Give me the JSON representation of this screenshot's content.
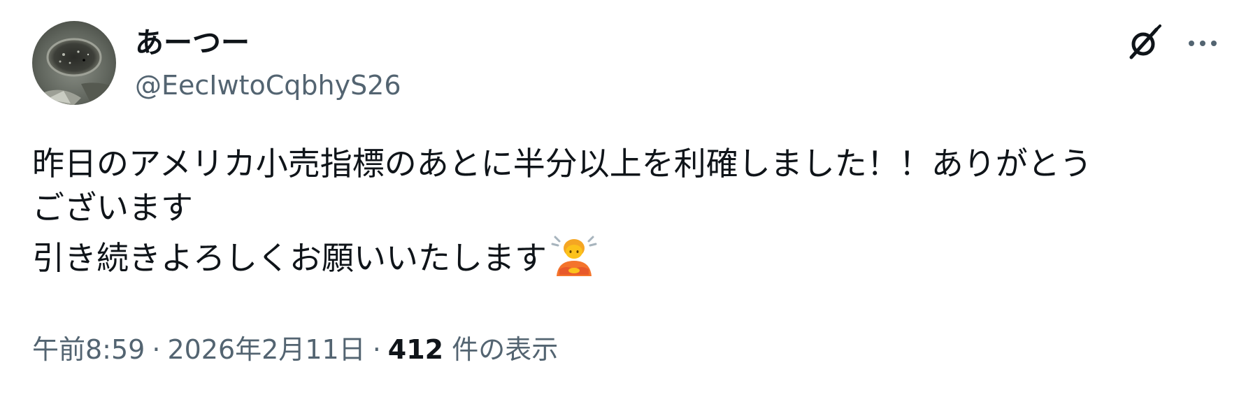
{
  "author": {
    "display_name": "あーつー",
    "handle": "@EecIwtoCqbhyS26",
    "avatar_icon": "profile-avatar-image"
  },
  "actions": {
    "grok_icon": "grok-icon",
    "more_icon": "more-options-icon"
  },
  "tweet": {
    "lines": [
      "昨日のアメリカ小売指標のあとに半分以上を利確しました！！ありがとう",
      "ございます",
      "引き続きよろしくお願いいたします"
    ],
    "emoji": "person-bowing-emoji"
  },
  "meta": {
    "time": "午前8:59",
    "separator": "·",
    "date": "2026年2月11日",
    "views_count": "412",
    "views_label": "件の表示"
  },
  "colors": {
    "text_primary": "#0f1419",
    "text_secondary": "#536471",
    "background": "#ffffff"
  }
}
